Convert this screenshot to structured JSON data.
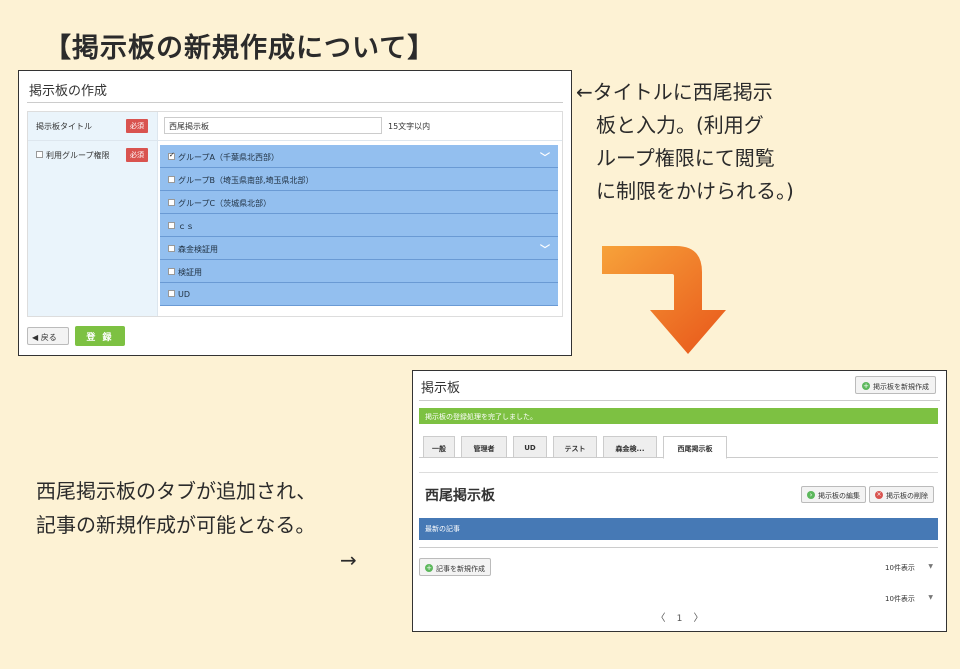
{
  "heading": "【掲示板の新規作成について】",
  "create_form": {
    "title": "掲示板の作成",
    "title_label": "掲示板タイトル",
    "required_badge": "必須",
    "title_value": "西尾掲示板",
    "title_limit": "15文字以内",
    "permission_label": "利用グループ権限",
    "groups": [
      {
        "label": "グループA（千葉県北西部）",
        "checked": true,
        "chevron": true
      },
      {
        "label": "グループB（埼玉県南部,埼玉県北部）",
        "checked": false,
        "chevron": false
      },
      {
        "label": "グループC（茨城県北部）",
        "checked": false,
        "chevron": false
      },
      {
        "label": "ｃｓ",
        "checked": false,
        "chevron": false
      },
      {
        "label": "森金検証用",
        "checked": false,
        "chevron": true
      },
      {
        "label": "検証用",
        "checked": false,
        "chevron": false
      },
      {
        "label": "UD",
        "checked": false,
        "chevron": false
      }
    ],
    "back_label": "戻る",
    "save_label": "登 録"
  },
  "note_top": [
    "←タイトルに西尾掲示",
    "　板と入力。(利用グ",
    "　ループ権限にて閲覧",
    "　に制限をかけられる。)"
  ],
  "board": {
    "title": "掲示板",
    "new_board_label": "掲示板を新規作成",
    "success_message": "掲示板の登録処理を完了しました。",
    "tabs": [
      "一般",
      "管理者",
      "UD",
      "テスト",
      "森金検...",
      "西尾掲示板"
    ],
    "active_tab_index": 5,
    "board_name": "西尾掲示板",
    "edit_label": "掲示板の編集",
    "delete_label": "掲示板の削除",
    "section_label": "最新の記事",
    "new_post_label": "記事を新規作成",
    "per_page_1": "10件表示",
    "per_page_2": "10件表示",
    "pager_prev": "〈",
    "pager_current": "1",
    "pager_next": "〉"
  },
  "note_bottom": [
    "西尾掲示板のタブが追加され、",
    "記事の新規作成が可能となる。"
  ],
  "note_bottom_arrow": "→",
  "colors": {
    "accent_green": "#7dc142",
    "group_blue": "#93bfef",
    "bar_blue": "#4679b5",
    "required_red": "#d9534f",
    "arrow_orange": "#f26b1d"
  }
}
